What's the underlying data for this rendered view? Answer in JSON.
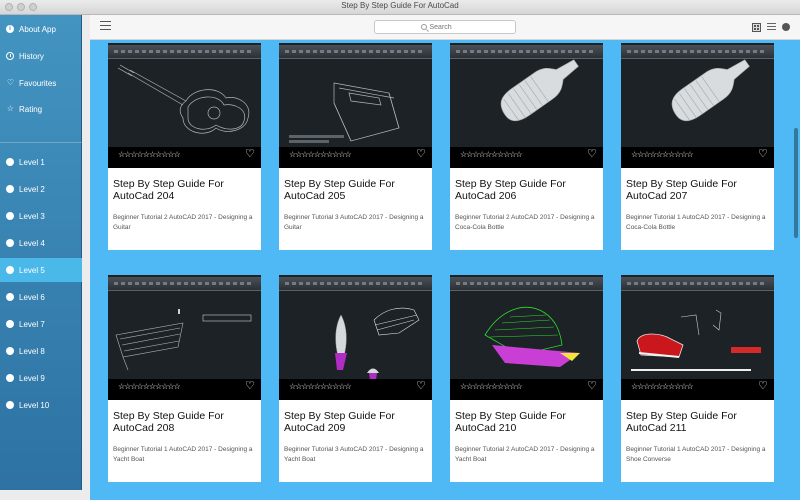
{
  "window": {
    "title": "Step By Step Guide For AutoCad"
  },
  "sidebar": {
    "top_items": [
      {
        "label": "About App",
        "icon": "info-icon"
      },
      {
        "label": "History",
        "icon": "clock-icon"
      },
      {
        "label": "Favourites",
        "icon": "heart-icon"
      },
      {
        "label": "Rating",
        "icon": "star-icon"
      }
    ],
    "levels": [
      {
        "label": "Level 1"
      },
      {
        "label": "Level 2"
      },
      {
        "label": "Level 3"
      },
      {
        "label": "Level 4"
      },
      {
        "label": "Level 5",
        "active": true
      },
      {
        "label": "Level 6"
      },
      {
        "label": "Level 7"
      },
      {
        "label": "Level 8"
      },
      {
        "label": "Level 9"
      },
      {
        "label": "Level 10"
      }
    ]
  },
  "toolbar": {
    "search_placeholder": "Search"
  },
  "stars_text": "☆☆☆☆☆☆☆☆☆☆",
  "cards": [
    {
      "title": "Step By Step Guide For AutoCad 204",
      "desc": "Beginner Tutorial 2 AutoCAD 2017 - Designing a Guitar",
      "shape": "guitar"
    },
    {
      "title": "Step By Step Guide For AutoCad 205",
      "desc": "Beginner Tutorial 3 AutoCAD 2017 - Designing a Guitar",
      "shape": "guitar-box"
    },
    {
      "title": "Step By Step Guide For AutoCad 206",
      "desc": "Beginner Tutorial 2 AutoCAD 2017 - Designing a Coca-Cola Bottle",
      "shape": "bottle"
    },
    {
      "title": "Step By Step Guide For AutoCad 207",
      "desc": "Beginner Tutorial 1 AutoCAD 2017 - Designing a Coca-Cola Bottle",
      "shape": "bottle"
    },
    {
      "title": "Step By Step Guide For AutoCad 208",
      "desc": "Beginner Tutorial 1 AutoCAD 2017 - Designing a Yacht Boat",
      "shape": "yacht-wire"
    },
    {
      "title": "Step By Step Guide For AutoCad 209",
      "desc": "Beginner Tutorial 3 AutoCAD 2017 - Designing a Yacht Boat",
      "shape": "yacht-sails"
    },
    {
      "title": "Step By Step Guide For AutoCad 210",
      "desc": "Beginner Tutorial 2 AutoCAD 2017 - Designing a Yacht Boat",
      "shape": "yacht-green"
    },
    {
      "title": "Step By Step Guide For AutoCad 211",
      "desc": "Beginner Tutorial 1 AutoCAD 2017 - Designing a Shoe Converse",
      "shape": "shoe"
    }
  ]
}
